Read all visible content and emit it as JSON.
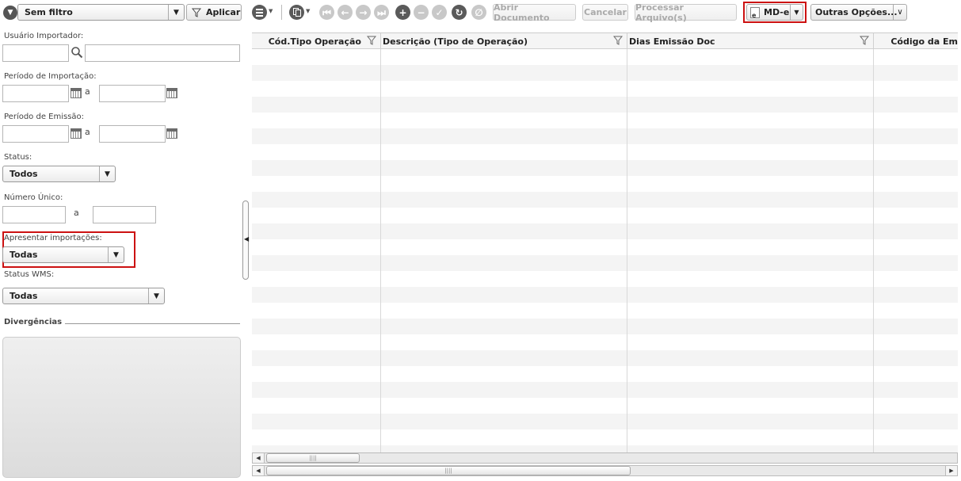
{
  "filter_bar": {
    "filter_select_value": "Sem filtro",
    "apply_label": "Aplicar"
  },
  "toolbar": {
    "open_document_label": "Abrir Documento",
    "cancel_label": "Cancelar",
    "process_files_label": "Processar Arquivo(s)",
    "mde_label": "MD-e",
    "more_options_label": "Outras Opções..."
  },
  "sidebar": {
    "user_importer_label": "Usuário Importador:",
    "import_period_label": "Período de Importação:",
    "emission_period_label": "Período de Emissão:",
    "range_separator": "a",
    "status_label": "Status:",
    "status_value": "Todos",
    "unique_number_label": "Número Único:",
    "show_imports_label": "Apresentar importações:",
    "show_imports_value": "Todas",
    "wms_status_label": "Status WMS:",
    "wms_status_value": "Todas",
    "divergences_label": "Divergências"
  },
  "grid": {
    "columns": [
      {
        "label": "Cód.Tipo Operação"
      },
      {
        "label": "Descrição (Tipo de Operação)"
      },
      {
        "label": "Dias Emissão Doc"
      },
      {
        "label": "Código da Em"
      }
    ]
  },
  "colors": {
    "highlight_border": "#cc1111",
    "row_alt": "#f4f4f4",
    "header_bg": "#f3f3f3"
  }
}
